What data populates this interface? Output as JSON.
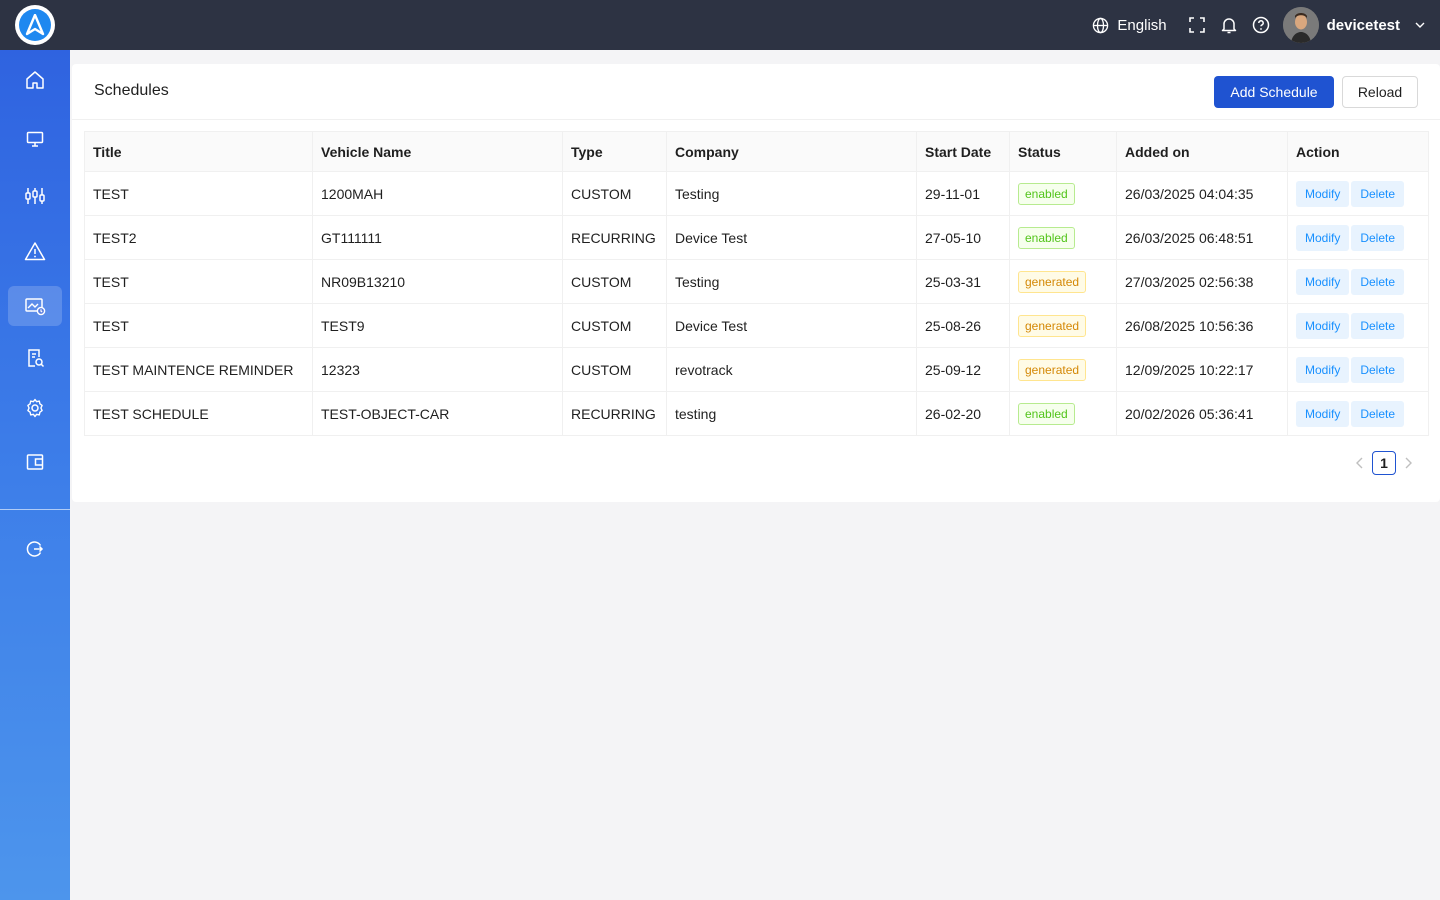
{
  "header": {
    "language": "English",
    "username": "devicetest"
  },
  "page": {
    "title": "Schedules",
    "add_button": "Add Schedule",
    "reload_button": "Reload"
  },
  "table": {
    "columns": [
      "Title",
      "Vehicle Name",
      "Type",
      "Company",
      "Start Date",
      "Status",
      "Added on",
      "Action"
    ],
    "rows": [
      {
        "title": "TEST",
        "vehicle": "1200MAH",
        "type": "CUSTOM",
        "company": "Testing",
        "start": "29-11-01",
        "status": "enabled",
        "added": "26/03/2025 04:04:35"
      },
      {
        "title": "TEST2",
        "vehicle": "GT111111",
        "type": "RECURRING",
        "company": "Device Test",
        "start": "27-05-10",
        "status": "enabled",
        "added": "26/03/2025 06:48:51"
      },
      {
        "title": "TEST",
        "vehicle": "NR09B13210",
        "type": "CUSTOM",
        "company": "Testing",
        "start": "25-03-31",
        "status": "generated",
        "added": "27/03/2025 02:56:38"
      },
      {
        "title": "TEST",
        "vehicle": "TEST9",
        "type": "CUSTOM",
        "company": "Device Test",
        "start": "25-08-26",
        "status": "generated",
        "added": "26/08/2025 10:56:36"
      },
      {
        "title": "TEST MAINTENCE REMINDER",
        "vehicle": "12323",
        "type": "CUSTOM",
        "company": "revotrack",
        "start": "25-09-12",
        "status": "generated",
        "added": "12/09/2025 10:22:17"
      },
      {
        "title": "TEST SCHEDULE",
        "vehicle": "TEST-OBJECT-CAR",
        "type": "RECURRING",
        "company": "testing",
        "start": "26-02-20",
        "status": "enabled",
        "added": "20/02/2026 05:36:41"
      }
    ],
    "actions": {
      "modify": "Modify",
      "delete": "Delete"
    }
  },
  "pagination": {
    "current_page": "1",
    "prev_icon": "chevron-left-icon",
    "next_icon": "chevron-right-icon"
  },
  "sidebar": {
    "items": [
      {
        "icon": "home-icon"
      },
      {
        "icon": "monitor-icon"
      },
      {
        "icon": "sliders-icon"
      },
      {
        "icon": "warning-icon"
      },
      {
        "icon": "schedule-icon",
        "active": true
      },
      {
        "icon": "report-search-icon"
      },
      {
        "icon": "gear-icon"
      },
      {
        "icon": "wallet-icon"
      },
      {
        "icon": "logout-icon"
      }
    ]
  },
  "colors": {
    "topbar": "#2d3343",
    "primary": "#1f53d1",
    "sidebar_top": "#2f63e0",
    "sidebar_bottom": "#4d95ec",
    "enabled": "#52c41a",
    "generated": "#d48806",
    "action_text": "#1890ff"
  }
}
